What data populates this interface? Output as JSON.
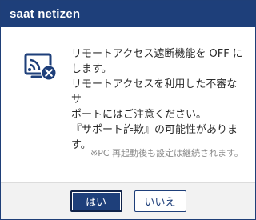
{
  "dialog": {
    "title": "saat netizen",
    "message_lines": [
      "リモートアクセス遮断機能を OFF に",
      "します。",
      "リモートアクセスを利用した不審なサ",
      "ポートにはご注意ください。",
      "『サポート詐欺』の可能性がありま",
      "す。"
    ],
    "note": "※PC 再起動後も設定は継続されます。",
    "icon": "remote-access-blocked-icon"
  },
  "buttons": {
    "yes_label": "はい",
    "no_label": "いいえ"
  },
  "colors": {
    "title_bar": "#1e3f7a",
    "icon": "#1e3f7a",
    "footer_bg": "#f2f2f2"
  }
}
